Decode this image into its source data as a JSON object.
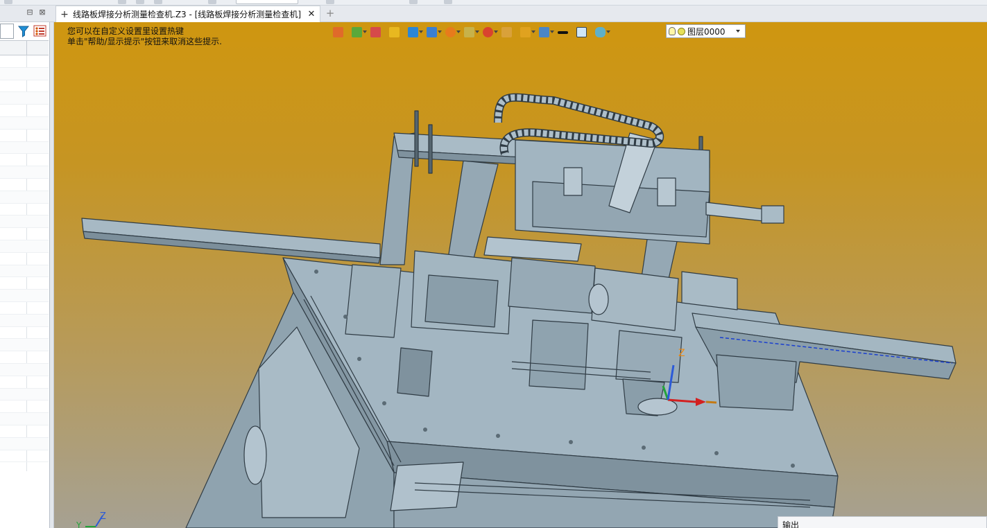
{
  "tabs": {
    "document_title": "线路板焊接分析测量检查机.Z3 - [线路板焊接分析测量检查机]",
    "close_glyph": "✕",
    "pin_glyph": "+",
    "new_tab_glyph": "+"
  },
  "viewport": {
    "hint_line1": "您可以在自定义设置里设置热键",
    "hint_line2": "单击\"帮助/显示提示\"按钮来取消这些提示.",
    "axis_labels": {
      "z": "Z",
      "y": "Y"
    },
    "background_colors": {
      "top": "#cf9610",
      "bottom": "#a6a192"
    }
  },
  "toolbar": {
    "layer_value": "图层0000",
    "icons": [
      "select-filter-icon",
      "pick-mode-icon",
      "pencil-icon",
      "shading-icon",
      "render-mode-icon",
      "view-orient-icon",
      "section-icon",
      "wireframe-icon",
      "zoom-icon",
      "rotate-icon",
      "measure-icon",
      "grid-icon",
      "line-style-icon",
      "color-icon",
      "visibility-icon"
    ]
  },
  "output_panel": {
    "title": "输出"
  },
  "colors": {
    "model_fill": "#9aaab5",
    "model_edge": "#2f3b44",
    "axis_x": "#d32020",
    "axis_y": "#22a43a",
    "axis_z": "#2b5ad8"
  }
}
